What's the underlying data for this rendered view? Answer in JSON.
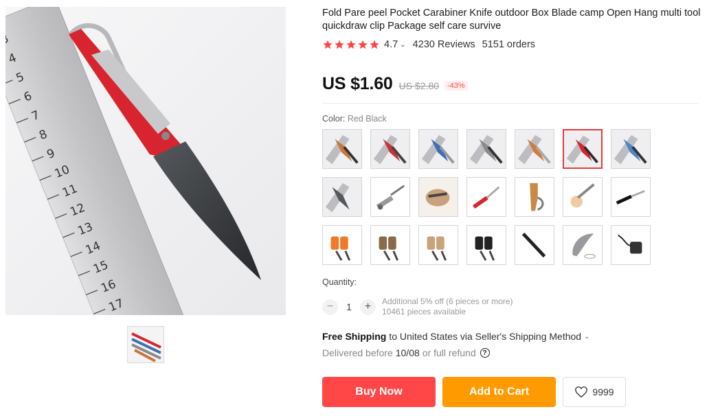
{
  "product": {
    "title": "Fold Pare peel Pocket Carabiner Knife outdoor Box Blade camp Open Hang multi tool quickdraw clip Package self care survive"
  },
  "rating": {
    "stars": 5,
    "value": "4.7",
    "chevron": "⌄",
    "reviews": "4230 Reviews",
    "orders": "5151 orders"
  },
  "price": {
    "current": "US $1.60",
    "original": "US $2.80",
    "discount": "-43%"
  },
  "color": {
    "label": "Color:",
    "selected": "Red Black",
    "options_count": 21,
    "selected_index": 5
  },
  "quantity": {
    "label": "Quantity:",
    "value": "1",
    "minus": "−",
    "plus": "+",
    "discount_note": "Additional 5% off (6 pieces or more)",
    "available": "10461 pieces available"
  },
  "shipping": {
    "free_label": "Free Shipping",
    "destination": "to United States via Seller's Shipping Method",
    "chevron": "⌄",
    "delivered_prefix": "Delivered before",
    "date": "10/08",
    "refund": "or full refund",
    "help_glyph": "?"
  },
  "actions": {
    "buy_now": "Buy Now",
    "add_to_cart": "Add to Cart",
    "wishlist_count": "9999"
  },
  "colors": {
    "red": "#ff4747",
    "orange": "#ff9a00",
    "star": "#ff4747",
    "selected_border": "#e4393c"
  },
  "icons": {
    "star": "star-icon",
    "heart": "heart-icon",
    "help": "help-icon"
  }
}
